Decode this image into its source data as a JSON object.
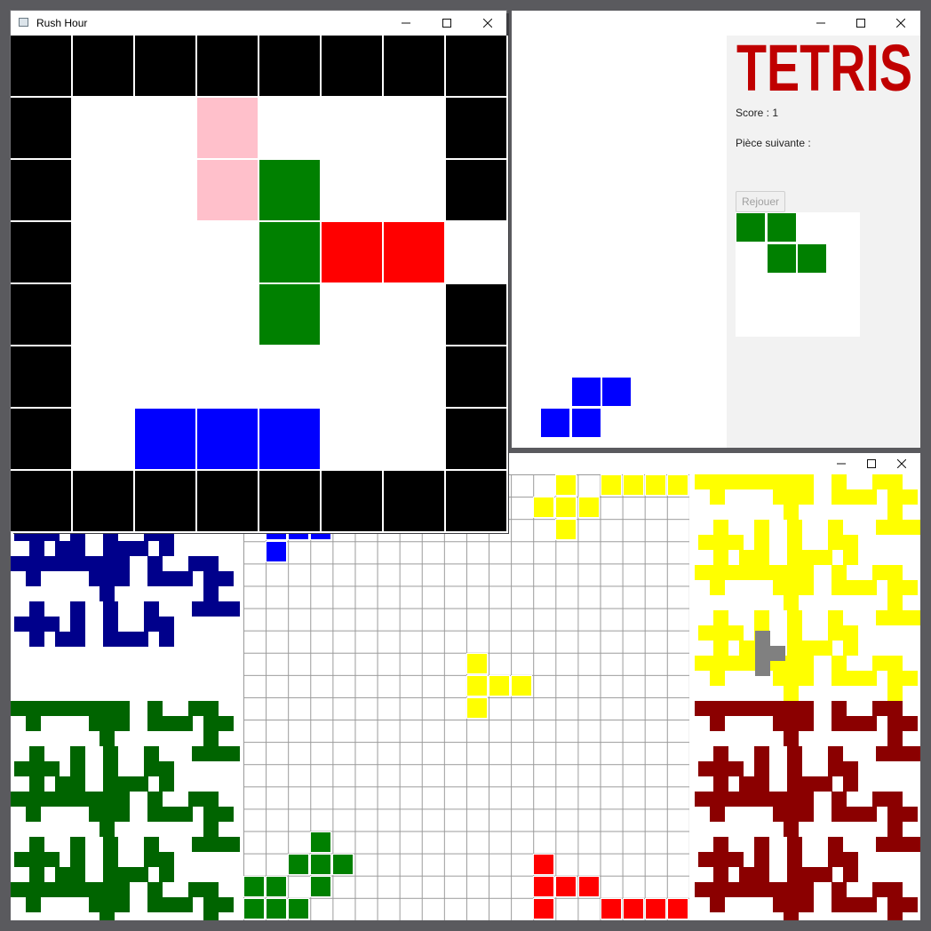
{
  "rush_hour": {
    "title": "Rush Hour",
    "colors": {
      "wall": "#000000",
      "empty": "#ffffff",
      "pink": "#ffc0cb",
      "green": "#008000",
      "red": "#ff0000",
      "blue": "#0000ff"
    },
    "grid": [
      "WWWWWWWW",
      "W..P...W",
      "W..PG..W",
      "W...GRR.",
      "W...G..W",
      "W......W",
      "W.BBB..W",
      "WWWWWWWW"
    ]
  },
  "tetris": {
    "logo_text": "TETRIS",
    "score_label": "Score : 1",
    "next_label": "Pièce suivante :",
    "replay_label": "Rejouer",
    "logo_color": "#c00000",
    "falling_piece": {
      "color": "#0000ff",
      "cells": [
        [
          1,
          0
        ],
        [
          2,
          0
        ],
        [
          0,
          1
        ],
        [
          1,
          1
        ]
      ]
    },
    "next_piece": {
      "color": "#008000",
      "cells": [
        [
          0,
          0
        ],
        [
          1,
          0
        ],
        [
          1,
          1
        ],
        [
          2,
          1
        ]
      ]
    }
  },
  "pentomino": {
    "colors": {
      "blue": "#00008b",
      "green": "#006400",
      "yellow": "#ffff00",
      "darkred": "#8b0000",
      "gray": "#808080",
      "placed_blue": "#0000ff",
      "placed_green": "#008000",
      "placed_yellow": "#ffff00",
      "placed_red": "#ff0000"
    }
  }
}
